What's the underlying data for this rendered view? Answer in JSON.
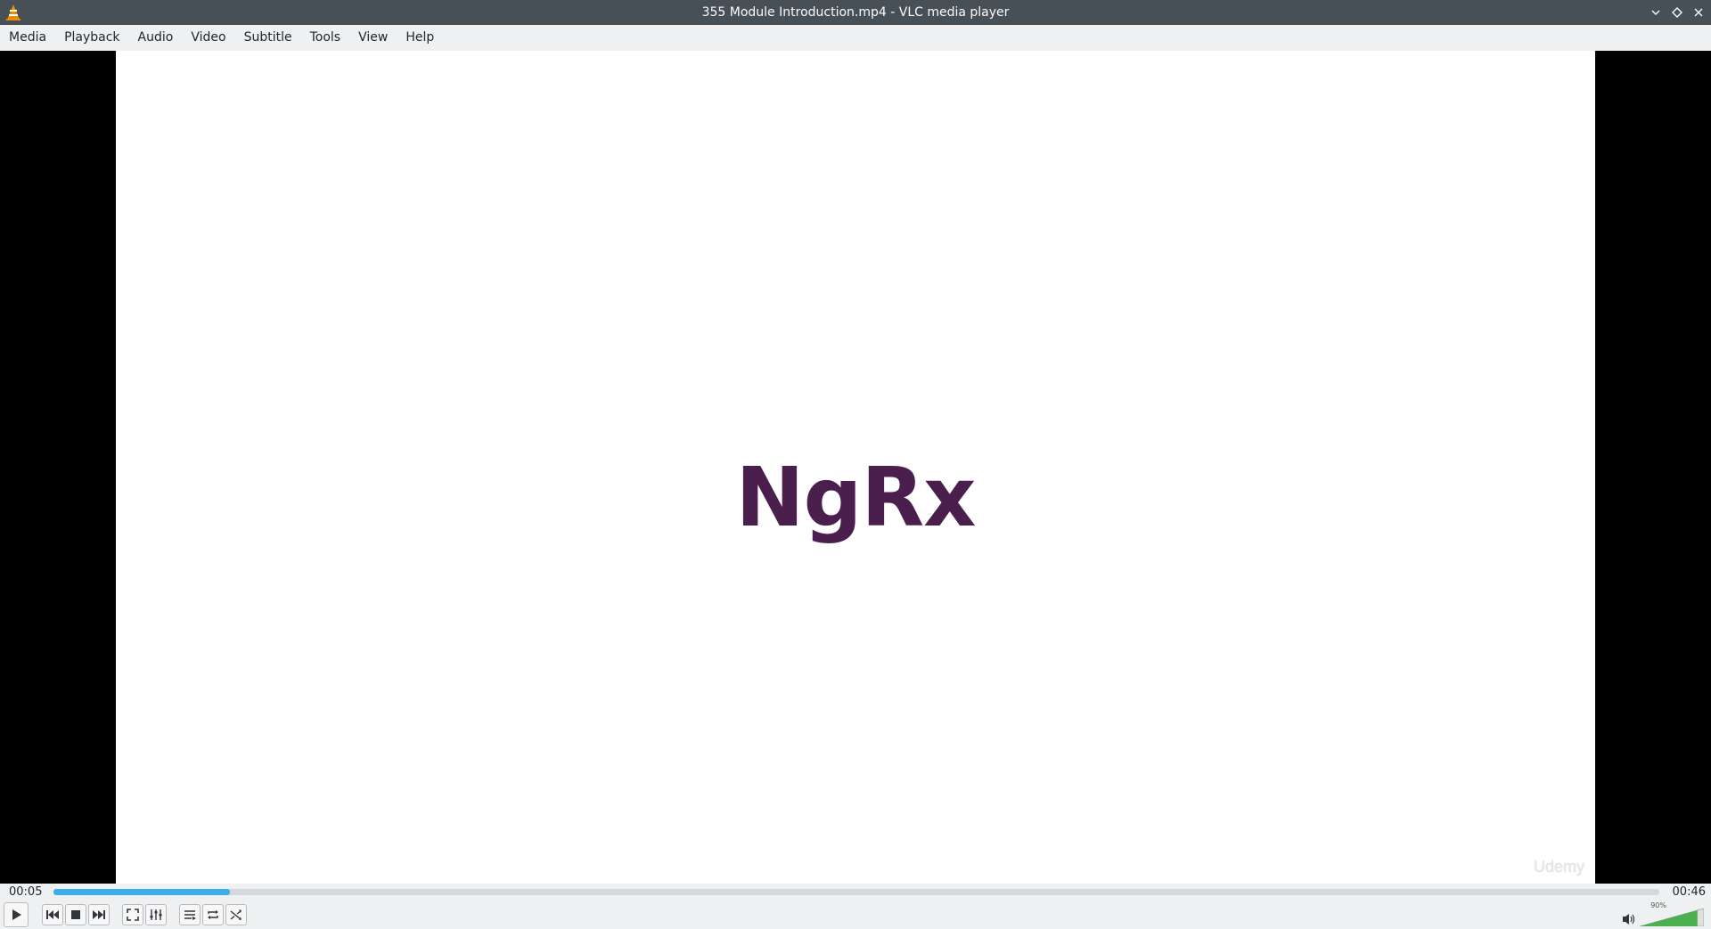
{
  "window": {
    "title": "355 Module Introduction.mp4 - VLC media player"
  },
  "menu": [
    {
      "label": "Media"
    },
    {
      "label": "Playback"
    },
    {
      "label": "Audio"
    },
    {
      "label": "Video"
    },
    {
      "label": "Subtitle"
    },
    {
      "label": "Tools"
    },
    {
      "label": "View"
    },
    {
      "label": "Help"
    }
  ],
  "video": {
    "slide_text": "NgRx",
    "watermark": "Udemy",
    "slide_text_color": "#4a1f4e"
  },
  "playback": {
    "elapsed": "00:05",
    "total": "00:46",
    "progress_fraction": 0.11
  },
  "controls": {
    "buttons": [
      "play-icon",
      "previous-icon",
      "stop-icon",
      "next-icon",
      "fullscreen-icon",
      "extended-settings-icon",
      "playlist-icon",
      "loop-icon",
      "shuffle-icon"
    ]
  },
  "volume": {
    "label": "90%",
    "level_fraction": 0.9,
    "color": "#4caf50"
  },
  "colors": {
    "titlebar": "#475057",
    "seek_fill": "#3daee9"
  }
}
